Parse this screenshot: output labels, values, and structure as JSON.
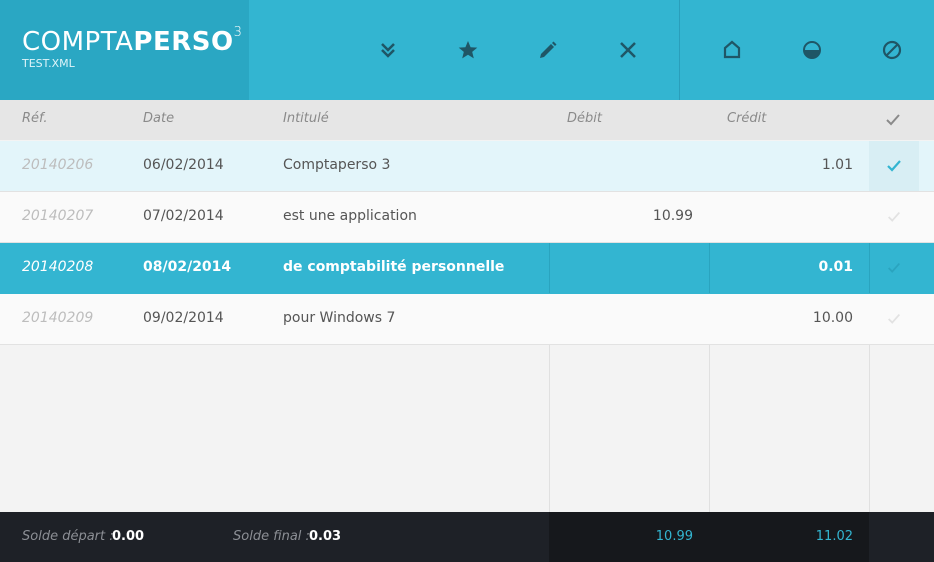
{
  "app": {
    "title_part1": "COMPTA",
    "title_part2": "PERSO",
    "title_sup": "3",
    "file": "TEST.XML"
  },
  "toolbar": [
    {
      "name": "expand-down-icon"
    },
    {
      "name": "star-icon"
    },
    {
      "name": "pencil-icon"
    },
    {
      "name": "close-icon"
    },
    {
      "name": "home-icon"
    },
    {
      "name": "half-circle-icon"
    },
    {
      "name": "forbidden-icon"
    }
  ],
  "columns": {
    "ref": "Réf.",
    "date": "Date",
    "label": "Intitulé",
    "debit": "Débit",
    "credit": "Crédit"
  },
  "rows": [
    {
      "ref": "20140206",
      "date": "06/02/2014",
      "label": "Comptaperso 3",
      "debit": "",
      "credit": "1.01",
      "checked": true
    },
    {
      "ref": "20140207",
      "date": "07/02/2014",
      "label": "est une application",
      "debit": "10.99",
      "credit": "",
      "checked": false
    },
    {
      "ref": "20140208",
      "date": "08/02/2014",
      "label": "de comptabilité personnelle",
      "debit": "",
      "credit": "0.01",
      "checked": false
    },
    {
      "ref": "20140209",
      "date": "09/02/2014",
      "label": "pour Windows 7",
      "debit": "",
      "credit": "10.00",
      "checked": false
    }
  ],
  "footer": {
    "start_label": "Solde départ :",
    "start_value": "0.00",
    "final_label": "Solde final :",
    "final_value": "0.03",
    "total_debit": "10.99",
    "total_credit": "11.02"
  },
  "colors": {
    "accent": "#33b5d1",
    "header_dark": "#2aa7c3",
    "footer": "#1e2127"
  }
}
